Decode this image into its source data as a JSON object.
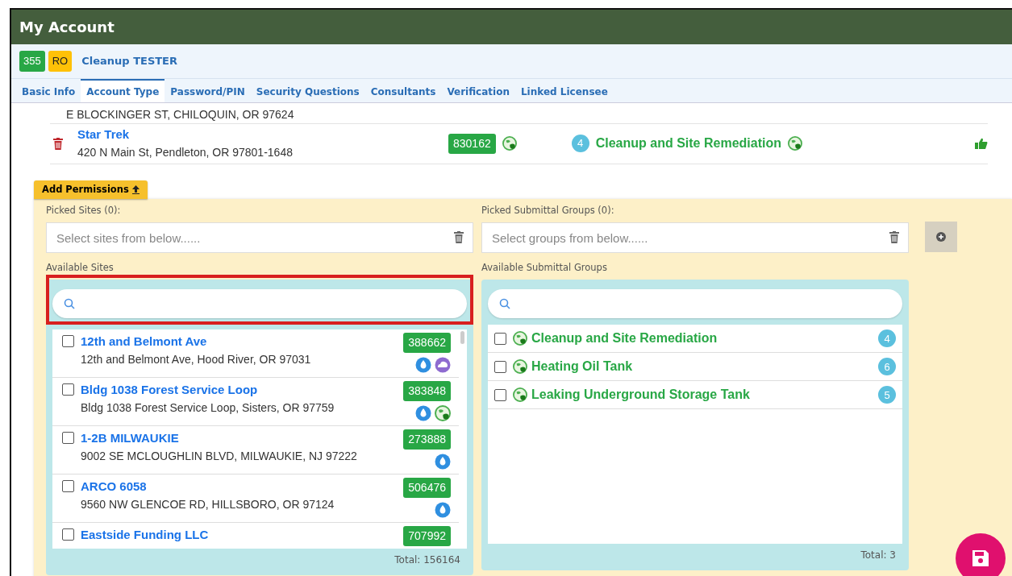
{
  "header": {
    "title": "My Account"
  },
  "account": {
    "id_badge": "355",
    "role_badge": "RO",
    "name": "Cleanup TESTER"
  },
  "tabs": [
    {
      "label": "Basic Info",
      "selected": false
    },
    {
      "label": "Account Type",
      "selected": true
    },
    {
      "label": "Password/PIN",
      "selected": false
    },
    {
      "label": "Security Questions",
      "selected": false
    },
    {
      "label": "Consultants",
      "selected": false
    },
    {
      "label": "Verification",
      "selected": false
    },
    {
      "label": "Linked Licensee",
      "selected": false
    }
  ],
  "permission_rows": [
    {
      "kind": "partial",
      "address": "E BLOCKINGER ST, CHILOQUIN, OR 97624"
    },
    {
      "kind": "full",
      "name": "Star Trek",
      "address": "420 N Main St, Pendleton, OR 97801-1648",
      "site_id": "830162",
      "group_count": "4",
      "group": "Cleanup and Site Remediation"
    }
  ],
  "add_permissions": {
    "label": "Add Permissions",
    "picked_sites_label": "Picked Sites (0):",
    "picked_sites_placeholder": "Select sites from below......",
    "picked_groups_label": "Picked Submittal Groups (0):",
    "picked_groups_placeholder": "Select groups from below......"
  },
  "available_sites": {
    "label": "Available Sites",
    "highlighted": true,
    "total": "Total: 156164",
    "items": [
      {
        "name": "12th and Belmont Ave",
        "address": "12th and Belmont Ave, Hood River, OR 97031",
        "site_id": "388662",
        "checked": false,
        "programs": [
          {
            "kind": "water"
          },
          {
            "kind": "cloud"
          }
        ]
      },
      {
        "name": "Bldg 1038 Forest Service Loop",
        "address": "Bldg 1038 Forest Service Loop, Sisters, OR 97759",
        "site_id": "383848",
        "checked": false,
        "programs": [
          {
            "kind": "water"
          },
          {
            "kind": "globe"
          }
        ]
      },
      {
        "name": "1-2B MILWAUKIE",
        "address": "9002 SE MCLOUGHLIN BLVD, MILWAUKIE, NJ 97222",
        "site_id": "273888",
        "checked": false,
        "programs": [
          {
            "kind": "water"
          }
        ]
      },
      {
        "name": "ARCO 6058",
        "address": "9560 NW GLENCOE RD, HILLSBORO, OR 97124",
        "site_id": "506476",
        "checked": false,
        "programs": [
          {
            "kind": "water"
          }
        ]
      },
      {
        "name": "Eastside Funding LLC",
        "site_id": "707992",
        "checked": false
      }
    ]
  },
  "available_groups": {
    "label": "Available Submittal Groups",
    "total": "Total: 3",
    "items": [
      {
        "name": "Cleanup and Site Remediation",
        "count": "4",
        "checked": false
      },
      {
        "name": "Heating Oil Tank",
        "count": "6",
        "checked": false
      },
      {
        "name": "Leaking Underground Storage Tank",
        "count": "5",
        "checked": false
      }
    ]
  }
}
